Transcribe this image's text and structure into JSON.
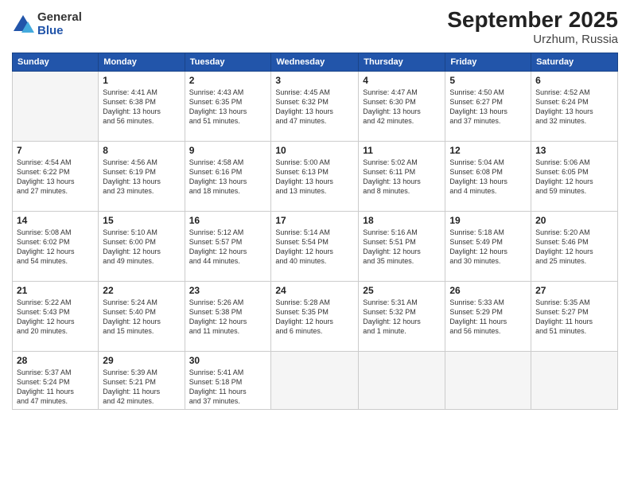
{
  "logo": {
    "general": "General",
    "blue": "Blue"
  },
  "title": "September 2025",
  "subtitle": "Urzhum, Russia",
  "days_of_week": [
    "Sunday",
    "Monday",
    "Tuesday",
    "Wednesday",
    "Thursday",
    "Friday",
    "Saturday"
  ],
  "weeks": [
    [
      {
        "day": "",
        "info": ""
      },
      {
        "day": "1",
        "info": "Sunrise: 4:41 AM\nSunset: 6:38 PM\nDaylight: 13 hours\nand 56 minutes."
      },
      {
        "day": "2",
        "info": "Sunrise: 4:43 AM\nSunset: 6:35 PM\nDaylight: 13 hours\nand 51 minutes."
      },
      {
        "day": "3",
        "info": "Sunrise: 4:45 AM\nSunset: 6:32 PM\nDaylight: 13 hours\nand 47 minutes."
      },
      {
        "day": "4",
        "info": "Sunrise: 4:47 AM\nSunset: 6:30 PM\nDaylight: 13 hours\nand 42 minutes."
      },
      {
        "day": "5",
        "info": "Sunrise: 4:50 AM\nSunset: 6:27 PM\nDaylight: 13 hours\nand 37 minutes."
      },
      {
        "day": "6",
        "info": "Sunrise: 4:52 AM\nSunset: 6:24 PM\nDaylight: 13 hours\nand 32 minutes."
      }
    ],
    [
      {
        "day": "7",
        "info": "Sunrise: 4:54 AM\nSunset: 6:22 PM\nDaylight: 13 hours\nand 27 minutes."
      },
      {
        "day": "8",
        "info": "Sunrise: 4:56 AM\nSunset: 6:19 PM\nDaylight: 13 hours\nand 23 minutes."
      },
      {
        "day": "9",
        "info": "Sunrise: 4:58 AM\nSunset: 6:16 PM\nDaylight: 13 hours\nand 18 minutes."
      },
      {
        "day": "10",
        "info": "Sunrise: 5:00 AM\nSunset: 6:13 PM\nDaylight: 13 hours\nand 13 minutes."
      },
      {
        "day": "11",
        "info": "Sunrise: 5:02 AM\nSunset: 6:11 PM\nDaylight: 13 hours\nand 8 minutes."
      },
      {
        "day": "12",
        "info": "Sunrise: 5:04 AM\nSunset: 6:08 PM\nDaylight: 13 hours\nand 4 minutes."
      },
      {
        "day": "13",
        "info": "Sunrise: 5:06 AM\nSunset: 6:05 PM\nDaylight: 12 hours\nand 59 minutes."
      }
    ],
    [
      {
        "day": "14",
        "info": "Sunrise: 5:08 AM\nSunset: 6:02 PM\nDaylight: 12 hours\nand 54 minutes."
      },
      {
        "day": "15",
        "info": "Sunrise: 5:10 AM\nSunset: 6:00 PM\nDaylight: 12 hours\nand 49 minutes."
      },
      {
        "day": "16",
        "info": "Sunrise: 5:12 AM\nSunset: 5:57 PM\nDaylight: 12 hours\nand 44 minutes."
      },
      {
        "day": "17",
        "info": "Sunrise: 5:14 AM\nSunset: 5:54 PM\nDaylight: 12 hours\nand 40 minutes."
      },
      {
        "day": "18",
        "info": "Sunrise: 5:16 AM\nSunset: 5:51 PM\nDaylight: 12 hours\nand 35 minutes."
      },
      {
        "day": "19",
        "info": "Sunrise: 5:18 AM\nSunset: 5:49 PM\nDaylight: 12 hours\nand 30 minutes."
      },
      {
        "day": "20",
        "info": "Sunrise: 5:20 AM\nSunset: 5:46 PM\nDaylight: 12 hours\nand 25 minutes."
      }
    ],
    [
      {
        "day": "21",
        "info": "Sunrise: 5:22 AM\nSunset: 5:43 PM\nDaylight: 12 hours\nand 20 minutes."
      },
      {
        "day": "22",
        "info": "Sunrise: 5:24 AM\nSunset: 5:40 PM\nDaylight: 12 hours\nand 15 minutes."
      },
      {
        "day": "23",
        "info": "Sunrise: 5:26 AM\nSunset: 5:38 PM\nDaylight: 12 hours\nand 11 minutes."
      },
      {
        "day": "24",
        "info": "Sunrise: 5:28 AM\nSunset: 5:35 PM\nDaylight: 12 hours\nand 6 minutes."
      },
      {
        "day": "25",
        "info": "Sunrise: 5:31 AM\nSunset: 5:32 PM\nDaylight: 12 hours\nand 1 minute."
      },
      {
        "day": "26",
        "info": "Sunrise: 5:33 AM\nSunset: 5:29 PM\nDaylight: 11 hours\nand 56 minutes."
      },
      {
        "day": "27",
        "info": "Sunrise: 5:35 AM\nSunset: 5:27 PM\nDaylight: 11 hours\nand 51 minutes."
      }
    ],
    [
      {
        "day": "28",
        "info": "Sunrise: 5:37 AM\nSunset: 5:24 PM\nDaylight: 11 hours\nand 47 minutes."
      },
      {
        "day": "29",
        "info": "Sunrise: 5:39 AM\nSunset: 5:21 PM\nDaylight: 11 hours\nand 42 minutes."
      },
      {
        "day": "30",
        "info": "Sunrise: 5:41 AM\nSunset: 5:18 PM\nDaylight: 11 hours\nand 37 minutes."
      },
      {
        "day": "",
        "info": ""
      },
      {
        "day": "",
        "info": ""
      },
      {
        "day": "",
        "info": ""
      },
      {
        "day": "",
        "info": ""
      }
    ]
  ]
}
